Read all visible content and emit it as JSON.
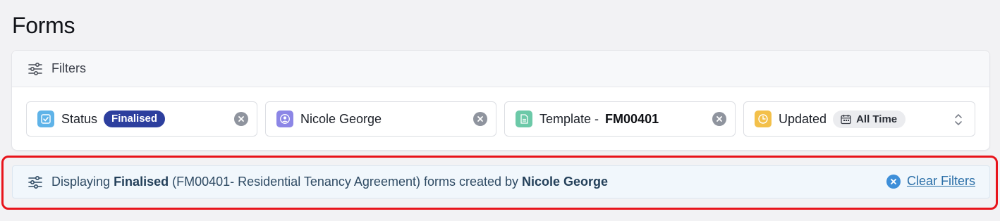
{
  "page": {
    "title": "Forms"
  },
  "filters": {
    "header_label": "Filters",
    "chips": {
      "status": {
        "label": "Status",
        "value": "Finalised"
      },
      "user": {
        "label": "Nicole George"
      },
      "template": {
        "label": "Template -",
        "value": "FM00401"
      },
      "updated": {
        "label": "Updated",
        "value": "All Time"
      }
    }
  },
  "summary": {
    "prefix": "Displaying",
    "status": "Finalised",
    "middle": "(FM00401- Residential Tenancy Agreement) forms created by",
    "user": "Nicole George",
    "clear_label": "Clear Filters"
  },
  "colors": {
    "status_badge": "#2d3f9e",
    "status_icon": "#5fb3e8",
    "user_icon": "#8c86e6",
    "template_icon": "#6cc9a8",
    "updated_icon": "#f3c04a",
    "highlight_frame": "#e8141b",
    "summary_background": "#f1f7fc",
    "clear_filters": "#3e8fd9"
  },
  "icons": {
    "filters": "sliders-icon",
    "status": "checkbox-icon",
    "user": "user-icon",
    "template": "document-icon",
    "updated": "clock-icon",
    "time_pill": "calendar-icon",
    "chip_clear": "close-circle-icon",
    "updated_select": "chevron-up-down-icon",
    "clear_filters": "close-circle-icon"
  }
}
